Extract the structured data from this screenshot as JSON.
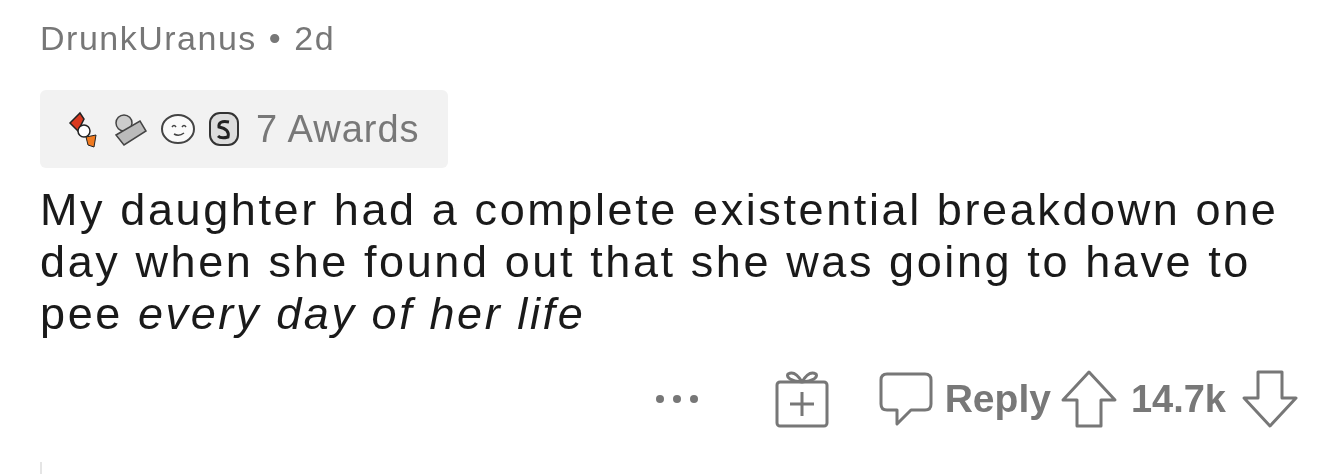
{
  "comment": {
    "author": "DrunkUranus",
    "separator": "•",
    "age": "2d",
    "awards": {
      "count_label": "7 Awards"
    },
    "body": "My daughter had a complete existential breakdown one day when she found out that she was going to have to pee *every day of her life*",
    "actions": {
      "reply": "Reply",
      "score": "14.7k"
    }
  }
}
